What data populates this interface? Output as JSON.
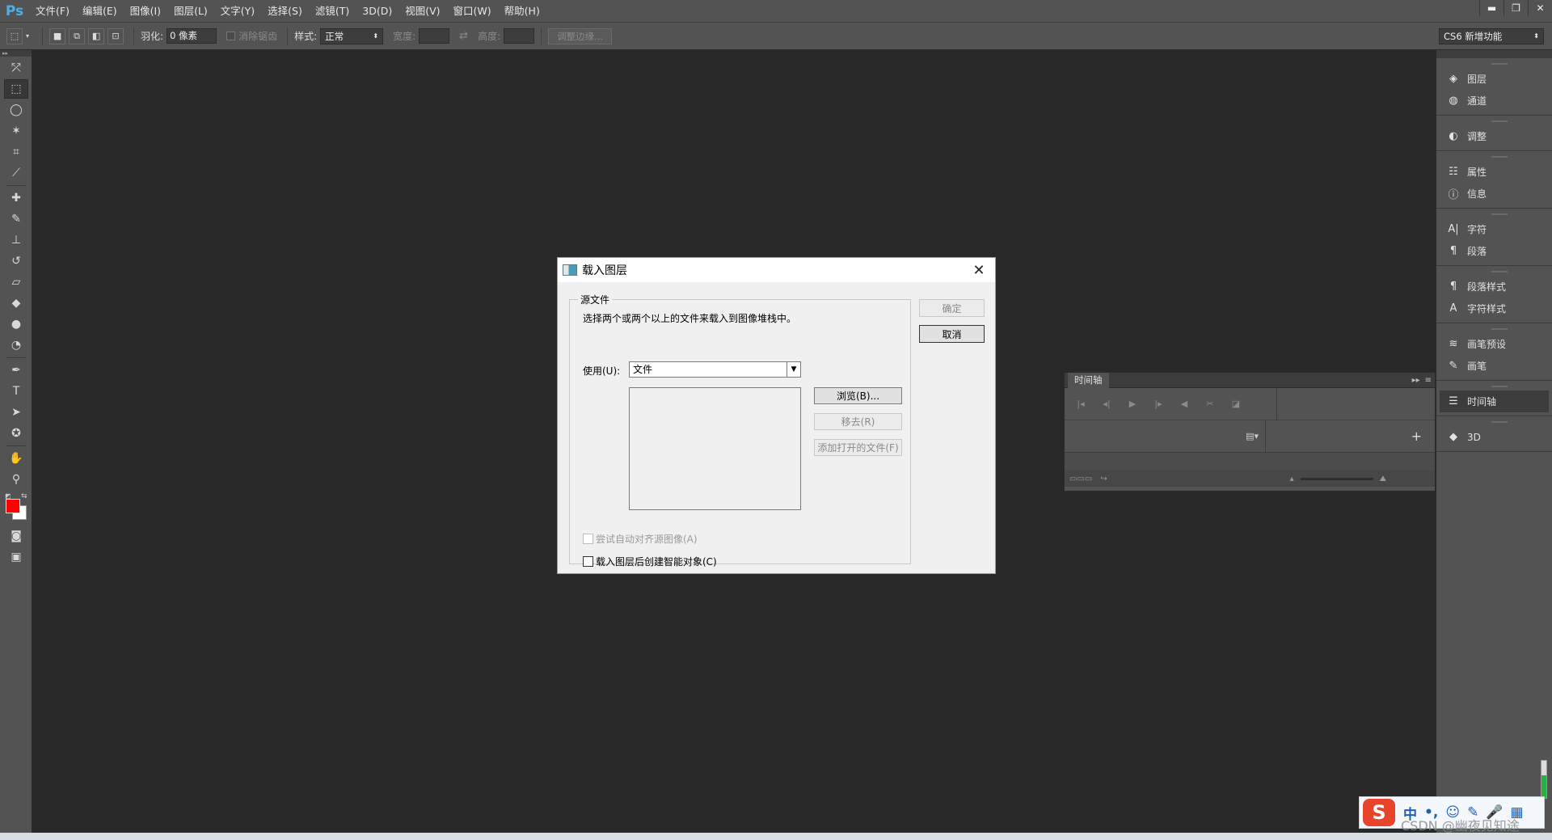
{
  "app": {
    "logo": "Ps"
  },
  "menu": [
    "文件(F)",
    "编辑(E)",
    "图像(I)",
    "图层(L)",
    "文字(Y)",
    "选择(S)",
    "滤镜(T)",
    "3D(D)",
    "视图(V)",
    "窗口(W)",
    "帮助(H)"
  ],
  "window_controls": {
    "minimize": "▬",
    "restore": "❐",
    "close": "✕"
  },
  "options": {
    "feather_label": "羽化:",
    "feather_value": "0 像素",
    "antialias_label": "消除锯齿",
    "style_label": "样式:",
    "style_value": "正常",
    "width_label": "宽度:",
    "height_label": "高度:",
    "refine_edge": "调整边缘...",
    "workspace": "CS6 新增功能"
  },
  "colors": {
    "foreground": "#ff0000",
    "background": "#ffffff",
    "ps_blue": "#4fb0e8",
    "ime_red": "#e8442b"
  },
  "tools": [
    "move-tool",
    "marquee-tool",
    "lasso-tool",
    "magic-wand-tool",
    "crop-tool",
    "eyedropper-tool",
    "healing-brush-tool",
    "brush-tool",
    "clone-stamp-tool",
    "history-brush-tool",
    "eraser-tool",
    "paint-bucket-tool",
    "blur-tool",
    "dodge-tool",
    "pen-tool",
    "type-tool",
    "path-selection-tool",
    "shape-tool",
    "hand-tool",
    "zoom-tool"
  ],
  "tool_glyphs": {
    "type": "T"
  },
  "dock": {
    "groups": [
      [
        {
          "label": "图层",
          "icon": "layers-icon",
          "glyph": "◈"
        },
        {
          "label": "通道",
          "icon": "channels-icon",
          "glyph": "◍"
        }
      ],
      [
        {
          "label": "调整",
          "icon": "adjustments-icon",
          "glyph": "◐"
        }
      ],
      [
        {
          "label": "属性",
          "icon": "properties-icon",
          "glyph": "☷"
        },
        {
          "label": "信息",
          "icon": "info-icon",
          "glyph": "ⓘ"
        }
      ],
      [
        {
          "label": "字符",
          "icon": "character-icon",
          "glyph": "A|"
        },
        {
          "label": "段落",
          "icon": "paragraph-icon",
          "glyph": "¶"
        }
      ],
      [
        {
          "label": "段落样式",
          "icon": "paragraph-styles-icon",
          "glyph": "¶"
        },
        {
          "label": "字符样式",
          "icon": "character-styles-icon",
          "glyph": "A"
        }
      ],
      [
        {
          "label": "画笔预设",
          "icon": "brush-presets-icon",
          "glyph": "≋"
        },
        {
          "label": "画笔",
          "icon": "brush-icon",
          "glyph": "✎"
        }
      ],
      [
        {
          "label": "时间轴",
          "icon": "timeline-icon",
          "glyph": "☰",
          "active": true
        }
      ],
      [
        {
          "label": "3D",
          "icon": "3d-cube-icon",
          "glyph": "◆"
        }
      ]
    ]
  },
  "timeline": {
    "title": "时间轴"
  },
  "dialog": {
    "title": "载入图层",
    "close": "✕",
    "fieldset_legend": "源文件",
    "description": "选择两个或两个以上的文件来载入到图像堆栈中。",
    "use_label": "使用(U):",
    "use_value": "文件",
    "browse": "浏览(B)...",
    "remove": "移去(R)",
    "add_open": "添加打开的文件(F)",
    "auto_align": "尝试自动对齐源图像(A)",
    "smart_object": "载入图层后创建智能对象(C)",
    "ok": "确定",
    "cancel": "取消"
  },
  "ime": {
    "logo": "S",
    "items": [
      "中",
      "•,",
      "☺",
      "✎",
      "🎤",
      "▦"
    ],
    "level": 0.6
  },
  "watermark": "CSDN @幽夜见知途"
}
